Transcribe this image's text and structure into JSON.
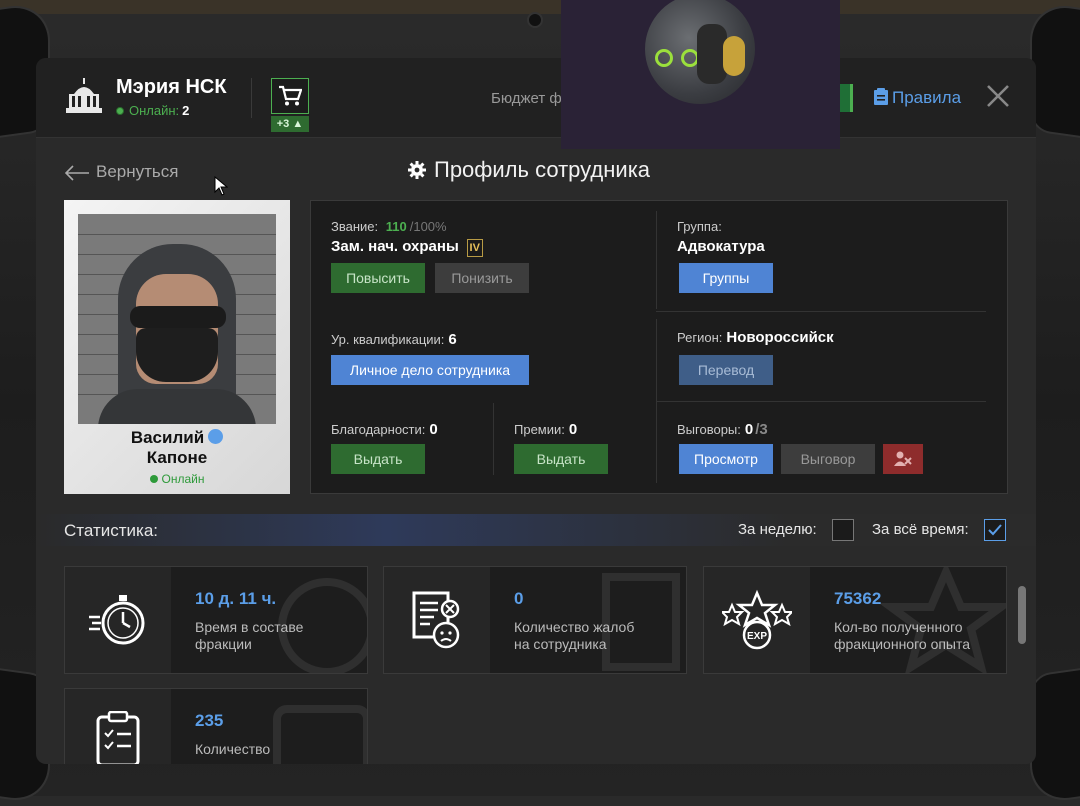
{
  "header": {
    "title": "Мэрия НСК",
    "online_label": "Онлайн:",
    "online_count": "2",
    "cart_badge": "+3",
    "budget_label": "Бюджет ф",
    "rules_label": "Правила"
  },
  "nav": {
    "back_label": "Вернуться",
    "page_title": "Профиль сотрудника"
  },
  "profile": {
    "first_name": "Василий",
    "last_name": "Капоне",
    "status": "Онлайн"
  },
  "info": {
    "rank_label": "Звание:",
    "rank_value": "110",
    "rank_max": "/100%",
    "position": "Зам. нач. охраны",
    "rank_roman": "IV",
    "promote_btn": "Повысить",
    "demote_btn": "Понизить",
    "group_label": "Группа:",
    "group_value": "Адвокатура",
    "groups_btn": "Группы",
    "qualification_label": "Ур. квалификации:",
    "qualification_value": "6",
    "personal_file_btn": "Личное дело сотрудника",
    "region_label": "Регион:",
    "region_value": "Новороссийск",
    "transfer_btn": "Перевод",
    "thanks_label": "Благодарности:",
    "thanks_value": "0",
    "thanks_btn": "Выдать",
    "bonus_label": "Премии:",
    "bonus_value": "0",
    "bonus_btn": "Выдать",
    "reprimand_label": "Выговоры:",
    "reprimand_value": "0",
    "reprimand_max": "/3",
    "view_btn": "Просмотр",
    "reprimand_btn": "Выговор"
  },
  "stats": {
    "title": "Статистика:",
    "week_label": "За неделю:",
    "alltime_label": "За всё время:",
    "cards": [
      {
        "value": "10 д. 11 ч.",
        "desc1": "Время в составе",
        "desc2": "фракции",
        "icon": "stopwatch-icon"
      },
      {
        "value": "0",
        "desc1": "Количество жалоб",
        "desc2": "на сотрудника",
        "icon": "complaint-icon"
      },
      {
        "value": "75362",
        "desc1": "Кол-во полученного",
        "desc2": "фракционного опыта",
        "icon": "exp-icon"
      },
      {
        "value": "235",
        "desc1": "Количество",
        "desc2": "",
        "icon": "clipboard-icon"
      }
    ]
  },
  "colors": {
    "accent_blue": "#5b9ee8",
    "accent_green": "#4caf50",
    "button_green": "#2e6b30",
    "button_red": "#8e2c2c"
  }
}
